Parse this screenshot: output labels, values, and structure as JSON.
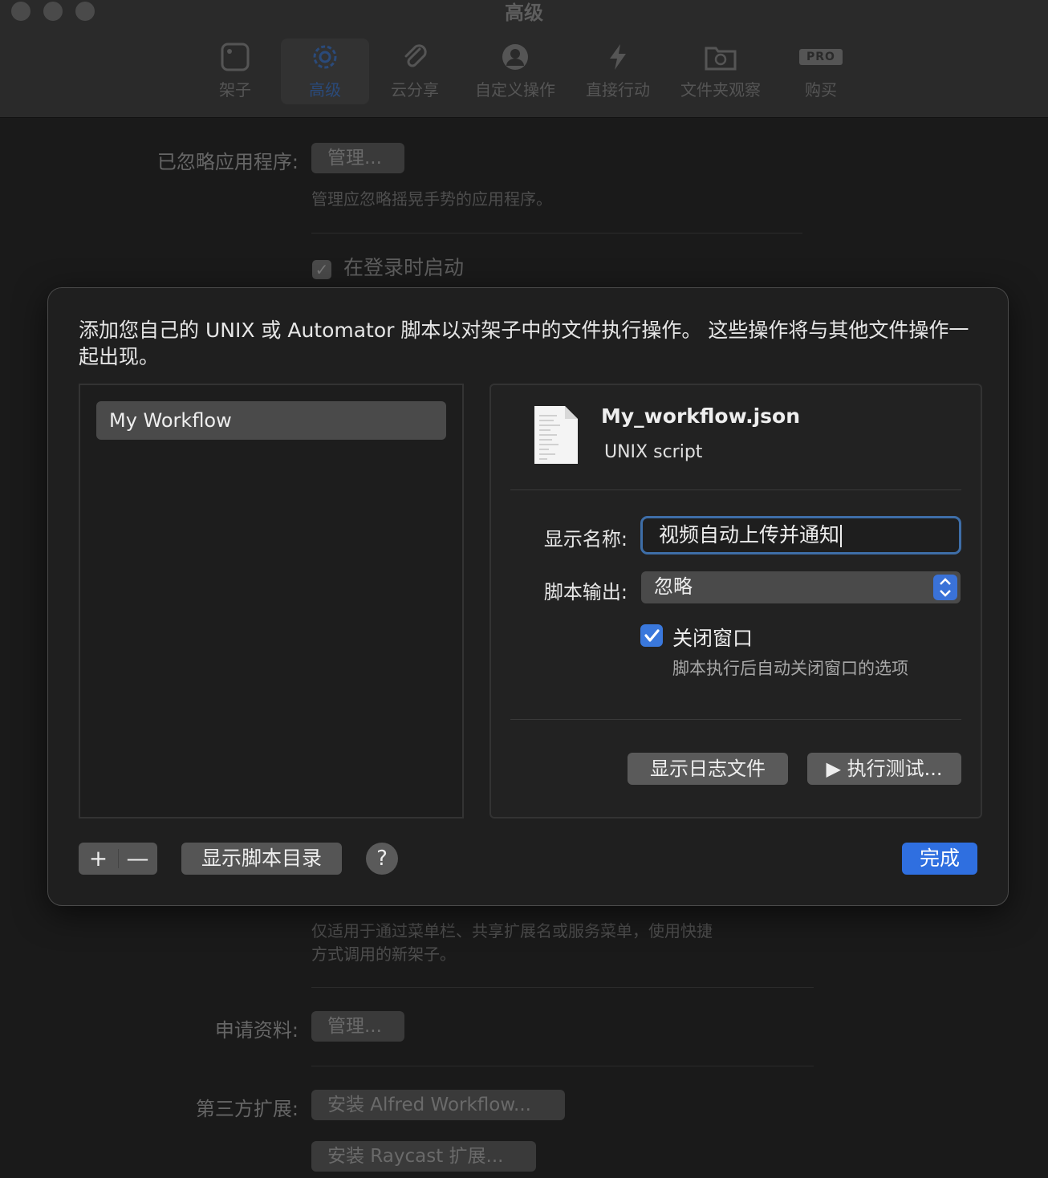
{
  "window": {
    "title": "高级"
  },
  "toolbar": {
    "items": [
      {
        "label": "架子",
        "icon": "shelf-icon"
      },
      {
        "label": "高级",
        "icon": "gear-icon",
        "active": true
      },
      {
        "label": "云分享",
        "icon": "paperclip-icon"
      },
      {
        "label": "自定义操作",
        "icon": "person-icon"
      },
      {
        "label": "直接行动",
        "icon": "bolt-icon"
      },
      {
        "label": "文件夹观察",
        "icon": "folder-sync-icon"
      },
      {
        "label": "购买",
        "icon": "pro-badge",
        "badge": "PRO"
      }
    ]
  },
  "background": {
    "ignored_apps_label": "已忽略应用程序:",
    "ignored_apps_button": "管理...",
    "ignored_apps_note": "管理应忽略摇晃手势的应用程序。",
    "launch_at_login": "在登录时启动",
    "launch_at_login_checked": true,
    "shortcut_note_line1": "仅适用于通过菜单栏、共享扩展名或服务菜单，使用快捷",
    "shortcut_note_line2": "方式调用的新架子。",
    "profile_label": "申请资料:",
    "profile_button": "管理...",
    "extensions_label": "第三方扩展:",
    "alfred_button": "安装 Alfred Workflow...",
    "raycast_button": "安装 Raycast 扩展..."
  },
  "sheet": {
    "description": "添加您自己的 UNIX 或 Automator 脚本以对架子中的文件执行操作。 这些操作将与其他文件操作一起出现。",
    "scripts": [
      "My Workflow"
    ],
    "detail": {
      "file_name": "My_workflow.json",
      "file_type": "UNIX script",
      "display_name_label": "显示名称:",
      "display_name_value": "视频自动上传并通知",
      "script_output_label": "脚本输出:",
      "script_output_value": "忽略",
      "close_window_label": "关闭窗口",
      "close_window_checked": true,
      "close_window_help": "脚本执行后自动关闭窗口的选项",
      "show_log_button": "显示日志文件",
      "run_test_button": "▶ 执行测试..."
    },
    "footer": {
      "add": "+",
      "remove": "—",
      "show_scripts_dir": "显示脚本目录",
      "help": "?",
      "done": "完成"
    }
  },
  "colors": {
    "accent": "#2f6fe0",
    "focus_ring": "#3e6ea8",
    "sheet_bg": "#1f1f1f"
  }
}
